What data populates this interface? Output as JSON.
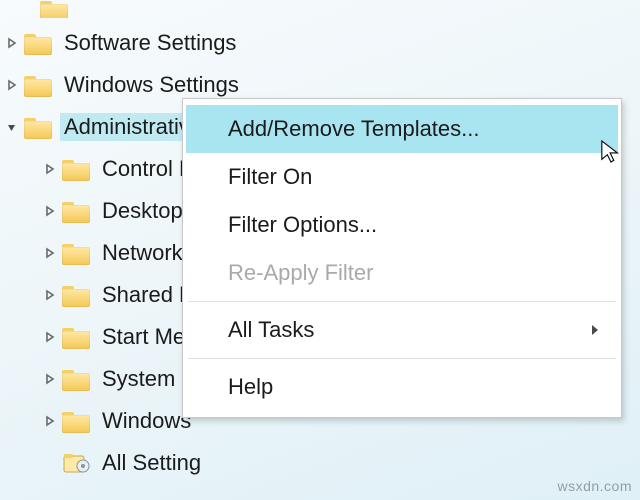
{
  "tree": {
    "top_cut_label": "",
    "items": [
      {
        "label": "Software Settings",
        "level": 1,
        "icon": "folder",
        "expander": "closed",
        "selected": false
      },
      {
        "label": "Windows Settings",
        "level": 1,
        "icon": "folder",
        "expander": "closed",
        "selected": false
      },
      {
        "label": "Administrative Templates",
        "level": 1,
        "icon": "folder",
        "expander": "open",
        "selected": true
      },
      {
        "label": "Control Panel",
        "level": 2,
        "icon": "folder",
        "expander": "closed",
        "selected": false,
        "truncated": "Control P"
      },
      {
        "label": "Desktop",
        "level": 2,
        "icon": "folder",
        "expander": "closed",
        "selected": false
      },
      {
        "label": "Network",
        "level": 2,
        "icon": "folder",
        "expander": "closed",
        "selected": false
      },
      {
        "label": "Shared Folders",
        "level": 2,
        "icon": "folder",
        "expander": "closed",
        "selected": false,
        "truncated": "Shared Fo"
      },
      {
        "label": "Start Menu",
        "level": 2,
        "icon": "folder",
        "expander": "closed",
        "selected": false,
        "truncated": "Start Mer"
      },
      {
        "label": "System",
        "level": 2,
        "icon": "folder",
        "expander": "closed",
        "selected": false
      },
      {
        "label": "Windows",
        "level": 2,
        "icon": "folder",
        "expander": "closed",
        "selected": false
      },
      {
        "label": "All Settings",
        "level": 2,
        "icon": "settings",
        "expander": "none",
        "selected": false,
        "truncated": "All Setting"
      }
    ]
  },
  "context_menu": {
    "items": [
      {
        "label": "Add/Remove Templates...",
        "enabled": true,
        "highlight": true,
        "submenu": false
      },
      {
        "label": "Filter On",
        "enabled": true,
        "highlight": false,
        "submenu": false
      },
      {
        "label": "Filter Options...",
        "enabled": true,
        "highlight": false,
        "submenu": false
      },
      {
        "label": "Re-Apply Filter",
        "enabled": false,
        "highlight": false,
        "submenu": false
      },
      {
        "separator": true
      },
      {
        "label": "All Tasks",
        "enabled": true,
        "highlight": false,
        "submenu": true
      },
      {
        "separator": true
      },
      {
        "label": "Help",
        "enabled": true,
        "highlight": false,
        "submenu": false
      }
    ]
  },
  "watermark": "wsxdn.com"
}
